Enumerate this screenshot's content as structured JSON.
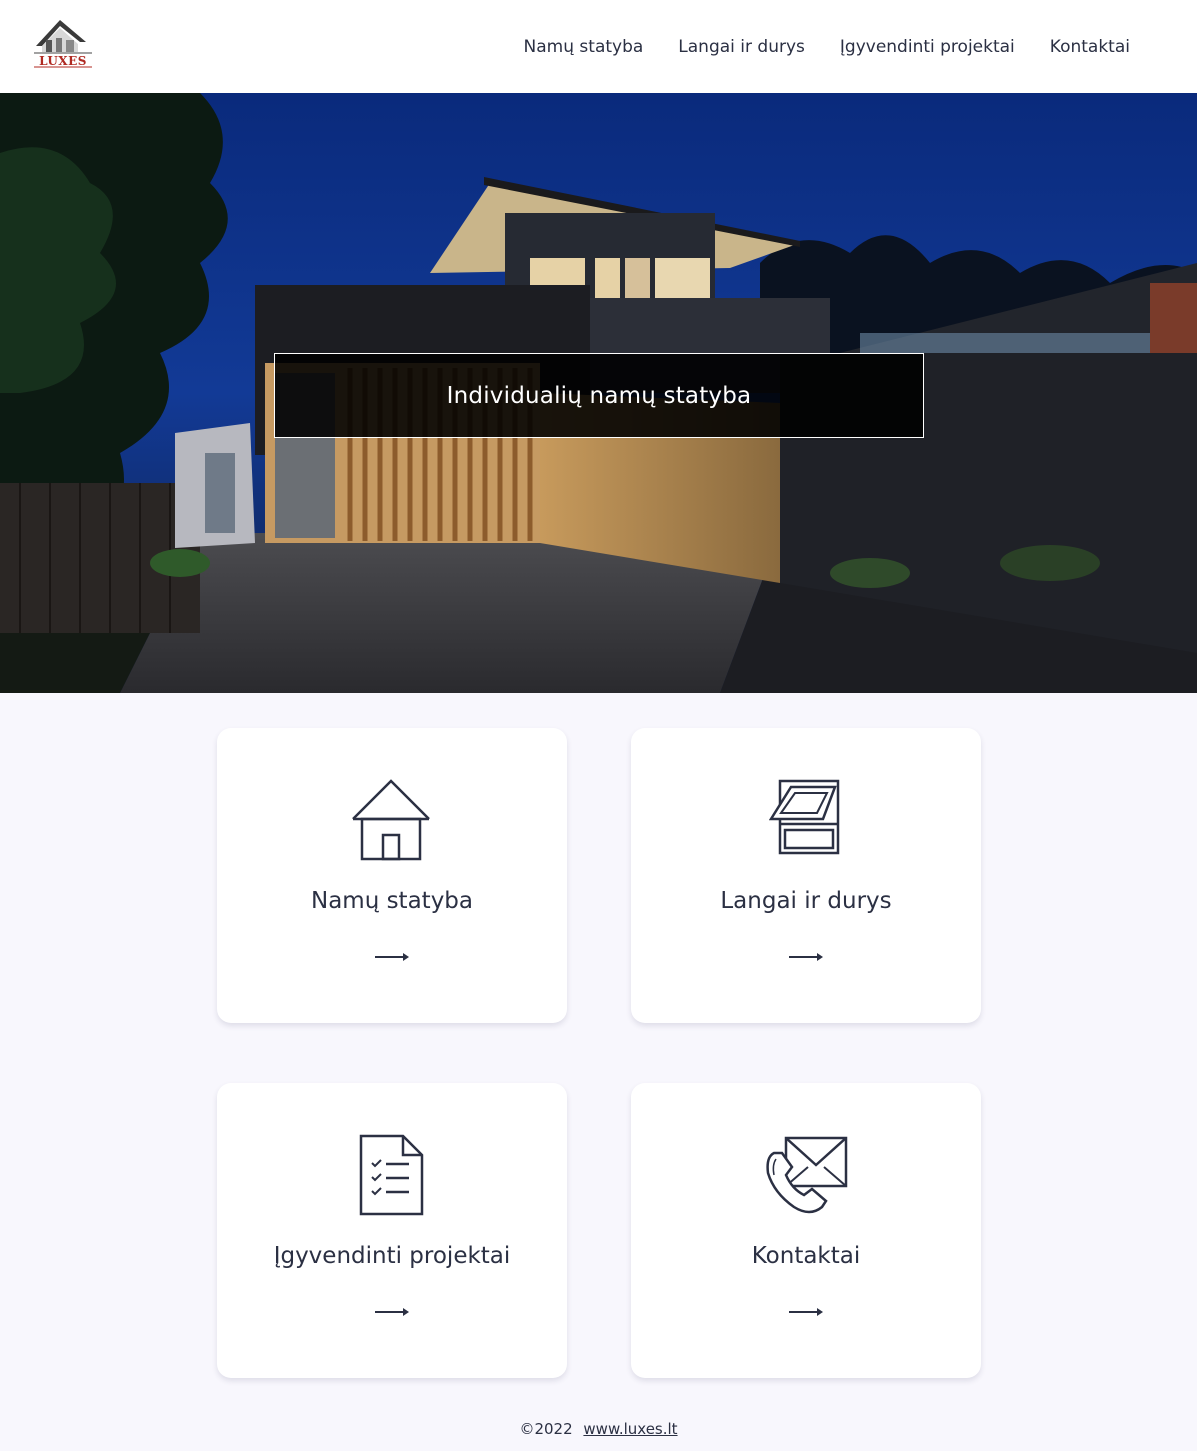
{
  "header": {
    "logo_text": "LUXES",
    "nav": [
      {
        "label": "Namų statyba"
      },
      {
        "label": "Langai ir durys"
      },
      {
        "label": "Įgyvendinti projektai"
      },
      {
        "label": "Kontaktai"
      }
    ]
  },
  "hero": {
    "title": "Individualių namų statyba"
  },
  "cards": [
    {
      "label": "Namų statyba",
      "icon": "house-icon"
    },
    {
      "label": "Langai ir durys",
      "icon": "window-icon"
    },
    {
      "label": "Įgyvendinti projektai",
      "icon": "checklist-document-icon"
    },
    {
      "label": "Kontaktai",
      "icon": "phone-envelope-icon"
    }
  ],
  "footer": {
    "copyright": "©2022",
    "link_text": "www.luxes.lt"
  },
  "colors": {
    "text": "#2b3043",
    "background": "#f8f7fd",
    "logo_red": "#b02a22"
  }
}
